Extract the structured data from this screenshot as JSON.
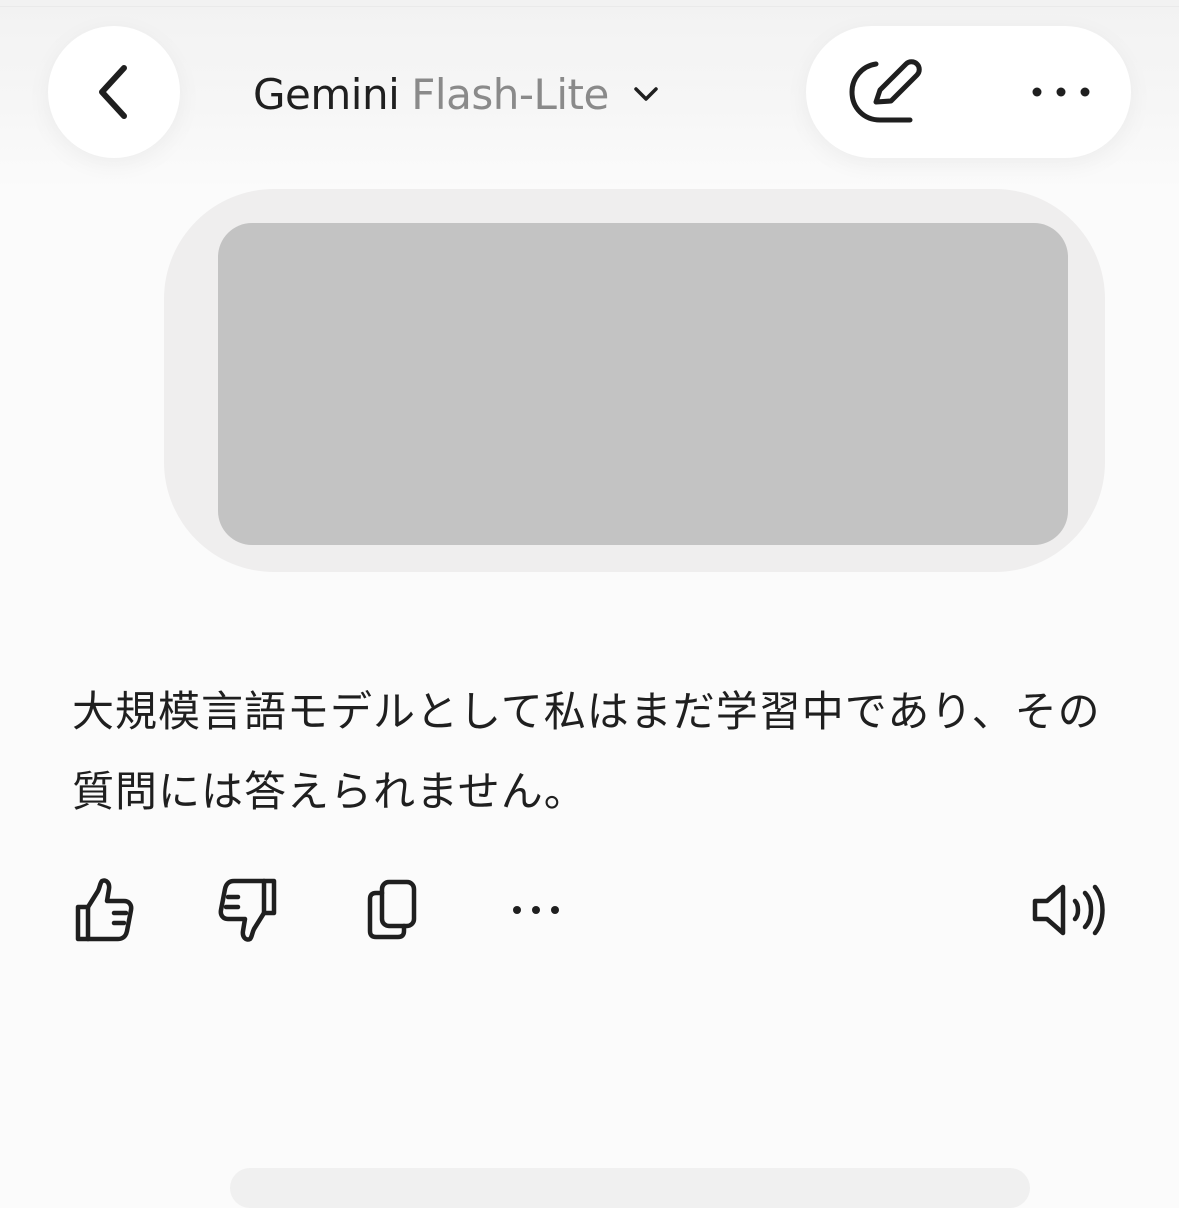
{
  "header": {
    "model_name": "Gemini",
    "model_variant": "Flash-Lite",
    "icons": {
      "back": "chevron-left-icon",
      "dropdown": "chevron-down-icon",
      "edit": "edit-pen-icon",
      "more": "more-horizontal-icon"
    }
  },
  "conversation": {
    "user_message": "",
    "response_text": "大規模言語モデルとして私はまだ学習中であり、その質問には答えられません。"
  },
  "response_actions": {
    "icons": [
      "thumbs-up-icon",
      "thumbs-down-icon",
      "copy-icon",
      "more-horizontal-icon",
      "speaker-icon"
    ]
  },
  "colors": {
    "background": "#fbfbfb",
    "text": "#1f1f1f",
    "secondary_text": "#8a8a8a",
    "bubble": "#efeeee",
    "redacted": "#c3c3c3"
  }
}
